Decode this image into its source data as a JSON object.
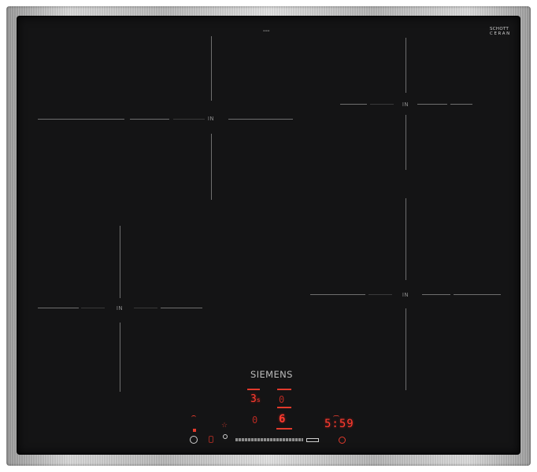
{
  "hob": {
    "brand": "SIEMENS",
    "glass_maker": [
      "SCHOTT",
      "CERAN"
    ],
    "zone_label": "IN",
    "left_display": {
      "top_value": "3",
      "top_suffix": "s",
      "bottom_value": "0"
    },
    "right_display": {
      "top_value": "0",
      "bottom_value": "6"
    },
    "timer": {
      "value": "5:59"
    },
    "accent_color": "#ff3b2f"
  }
}
